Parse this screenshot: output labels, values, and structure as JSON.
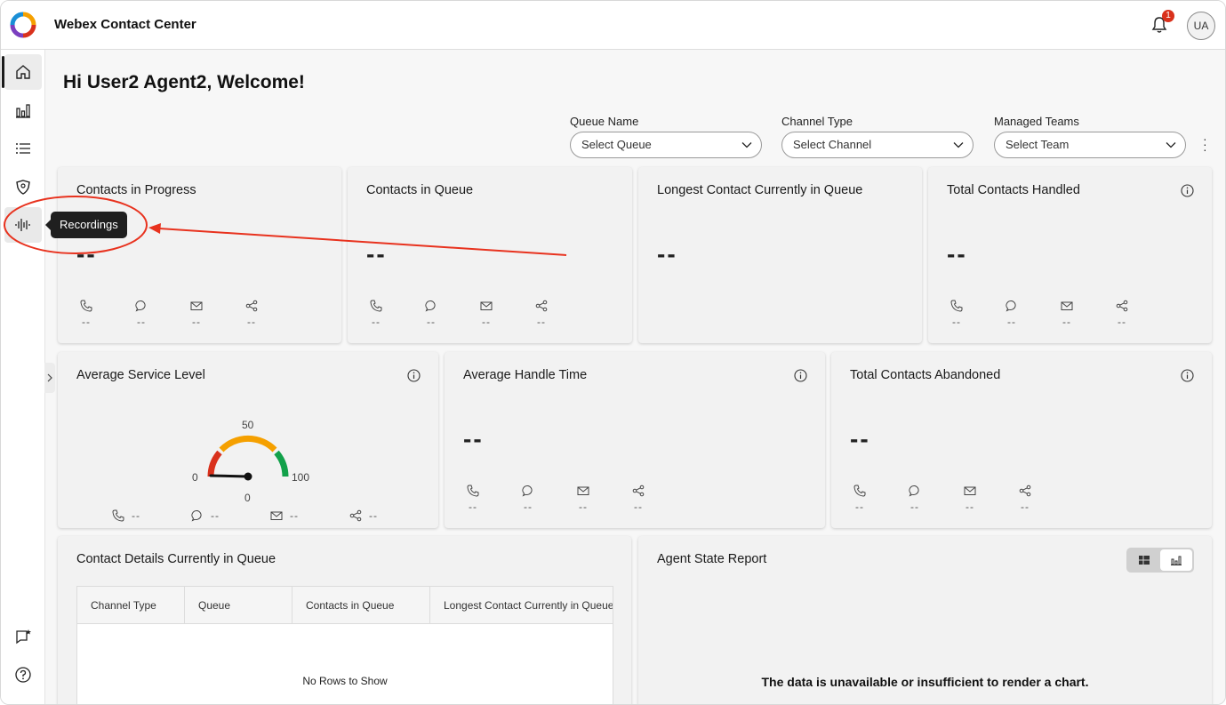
{
  "app": {
    "title": "Webex Contact Center"
  },
  "header": {
    "notification_count": "1",
    "avatar_initials": "UA"
  },
  "sidebar": {
    "items": [
      {
        "name": "home",
        "icon": "home-icon",
        "active": true
      },
      {
        "name": "analytics",
        "icon": "bar-chart-icon"
      },
      {
        "name": "list",
        "icon": "list-icon"
      },
      {
        "name": "teams",
        "icon": "team-shield-icon"
      },
      {
        "name": "recordings",
        "icon": "waveform-icon"
      }
    ],
    "bottom_items": [
      {
        "name": "feedback",
        "icon": "chat-feedback-icon"
      },
      {
        "name": "help",
        "icon": "help-icon"
      }
    ],
    "tooltip": "Recordings"
  },
  "main": {
    "welcome": "Hi User2 Agent2, Welcome!",
    "filters": [
      {
        "label": "Queue Name",
        "placeholder": "Select Queue"
      },
      {
        "label": "Channel Type",
        "placeholder": "Select Channel"
      },
      {
        "label": "Managed Teams",
        "placeholder": "Select Team"
      }
    ],
    "cards": {
      "contacts_in_progress": {
        "title": "Contacts in Progress",
        "value": "--",
        "channels": [
          "--",
          "--",
          "--",
          "--"
        ]
      },
      "contacts_in_queue": {
        "title": "Contacts in Queue",
        "value": "--",
        "channels": [
          "--",
          "--",
          "--",
          "--"
        ]
      },
      "longest_contact": {
        "title": "Longest Contact Currently in Queue",
        "value": "--"
      },
      "total_handled": {
        "title": "Total Contacts Handled",
        "value": "--",
        "channels": [
          "--",
          "--",
          "--",
          "--"
        ]
      },
      "avg_service_level": {
        "title": "Average Service Level",
        "gauge": {
          "min": "0",
          "mid": "50",
          "max": "100",
          "value": "0"
        },
        "channels": [
          "--",
          "--",
          "--",
          "--"
        ]
      },
      "avg_handle_time": {
        "title": "Average Handle Time",
        "value": "--",
        "channels": [
          "--",
          "--",
          "--",
          "--"
        ]
      },
      "total_abandoned": {
        "title": "Total Contacts Abandoned",
        "value": "--",
        "channels": [
          "--",
          "--",
          "--",
          "--"
        ]
      },
      "contact_details": {
        "title": "Contact Details Currently in Queue",
        "columns": [
          "Channel Type",
          "Queue",
          "Contacts in Queue",
          "Longest Contact Currently in Queue"
        ],
        "empty_text": "No Rows to Show"
      },
      "agent_state": {
        "title": "Agent State Report",
        "empty_text": "The data is unavailable or insufficient to render a chart."
      }
    }
  },
  "colors": {
    "annotation": "#e8321e",
    "gauge_red": "#d9311c",
    "gauge_orange": "#f5a000",
    "gauge_green": "#12a14a"
  }
}
